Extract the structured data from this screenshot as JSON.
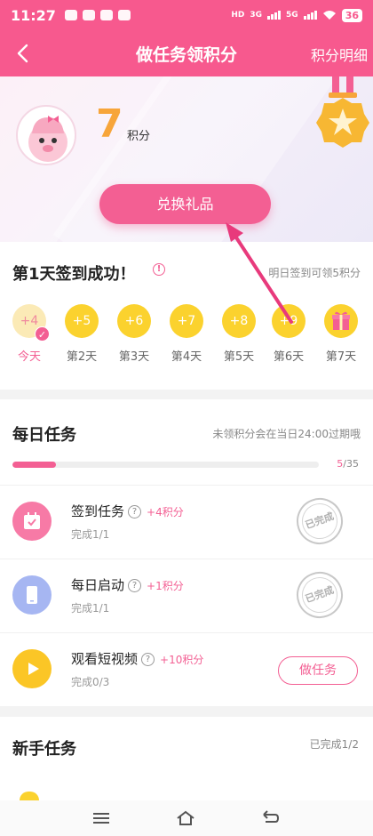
{
  "status": {
    "time": "11:27",
    "net1": "HD",
    "net2": "3G",
    "net3": "5G",
    "battery": "36"
  },
  "nav": {
    "title": "做任务领积分",
    "detail_link": "积分明细"
  },
  "header": {
    "points": "7",
    "points_unit": "积分",
    "exchange_button": "兑换礼品"
  },
  "signin": {
    "title": "第1天签到成功！",
    "info_icon": "!",
    "tip": "明日签到可领5积分",
    "days": [
      {
        "reward": "+4",
        "label": "今天",
        "done": true
      },
      {
        "reward": "+5",
        "label": "第2天"
      },
      {
        "reward": "+6",
        "label": "第3天"
      },
      {
        "reward": "+7",
        "label": "第4天"
      },
      {
        "reward": "+8",
        "label": "第5天"
      },
      {
        "reward": "+9",
        "label": "第6天"
      },
      {
        "reward": "gift-icon",
        "label": "第7天"
      }
    ]
  },
  "daily": {
    "title": "每日任务",
    "expire_note": "未领积分会在当日24:00过期哦",
    "progress": {
      "current": "5",
      "total": "/35",
      "fraction": 0.143
    },
    "tasks": [
      {
        "name": "签到任务",
        "help": "?",
        "reward": "+4积分",
        "progress": "完成1/1",
        "status": "已完成",
        "icon": "calendar-icon",
        "color": "#f77aa6"
      },
      {
        "name": "每日启动",
        "help": "?",
        "reward": "+1积分",
        "progress": "完成1/1",
        "status": "已完成",
        "icon": "tablet-icon",
        "color": "#a6b6f2"
      },
      {
        "name": "观看短视频",
        "help": "?",
        "reward": "+10积分",
        "progress": "完成0/3",
        "status": "做任务",
        "icon": "play-icon",
        "color": "#fbc626"
      }
    ]
  },
  "novice": {
    "title": "新手任务",
    "done": "已完成1/2"
  },
  "colors": {
    "brand": "#f7598e",
    "accent": "#f35f93",
    "gold": "#fbd22e",
    "points": "#f7a53a"
  }
}
